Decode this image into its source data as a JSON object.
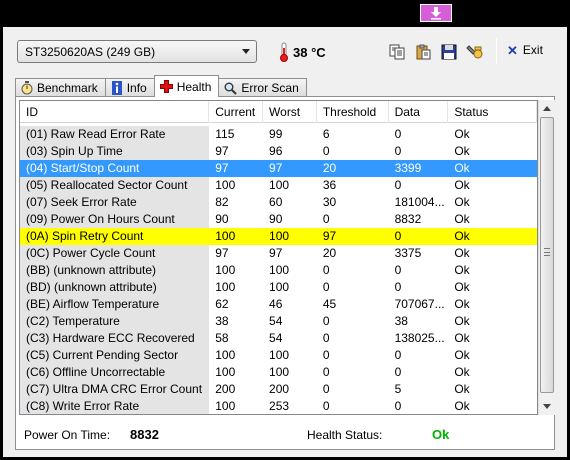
{
  "drive": {
    "selected": "ST3250620AS (249 GB)"
  },
  "temperature": {
    "value": "38 °C"
  },
  "toolbar": {
    "exit_label": "Exit"
  },
  "tabs": [
    {
      "label": "Benchmark",
      "icon": "stopwatch-icon"
    },
    {
      "label": "Info",
      "icon": "info-icon"
    },
    {
      "label": "Health",
      "icon": "red-cross-icon",
      "active": true
    },
    {
      "label": "Error Scan",
      "icon": "magnifier-icon"
    }
  ],
  "table": {
    "columns": [
      "ID",
      "Current",
      "Worst",
      "Threshold",
      "Data",
      "Status"
    ],
    "rows": [
      [
        "(01) Raw Read Error Rate",
        "115",
        "99",
        "6",
        "0",
        "Ok"
      ],
      [
        "(03) Spin Up Time",
        "97",
        "96",
        "0",
        "0",
        "Ok"
      ],
      [
        "(04) Start/Stop Count",
        "97",
        "97",
        "20",
        "3399",
        "Ok"
      ],
      [
        "(05) Reallocated Sector Count",
        "100",
        "100",
        "36",
        "0",
        "Ok"
      ],
      [
        "(07) Seek Error Rate",
        "82",
        "60",
        "30",
        "181004...",
        "Ok"
      ],
      [
        "(09) Power On Hours Count",
        "90",
        "90",
        "0",
        "8832",
        "Ok"
      ],
      [
        "(0A) Spin Retry Count",
        "100",
        "100",
        "97",
        "0",
        "Ok"
      ],
      [
        "(0C) Power Cycle Count",
        "97",
        "97",
        "20",
        "3375",
        "Ok"
      ],
      [
        "(BB) (unknown attribute)",
        "100",
        "100",
        "0",
        "0",
        "Ok"
      ],
      [
        "(BD) (unknown attribute)",
        "100",
        "100",
        "0",
        "0",
        "Ok"
      ],
      [
        "(BE) Airflow Temperature",
        "62",
        "46",
        "45",
        "707067...",
        "Ok"
      ],
      [
        "(C2) Temperature",
        "38",
        "54",
        "0",
        "38",
        "Ok"
      ],
      [
        "(C3) Hardware ECC Recovered",
        "58",
        "54",
        "0",
        "138025...",
        "Ok"
      ],
      [
        "(C5) Current Pending Sector",
        "100",
        "100",
        "0",
        "0",
        "Ok"
      ],
      [
        "(C6) Offline Uncorrectable",
        "100",
        "100",
        "0",
        "0",
        "Ok"
      ],
      [
        "(C7) Ultra DMA CRC Error Count",
        "200",
        "200",
        "0",
        "5",
        "Ok"
      ],
      [
        "(C8) Write Error Rate",
        "100",
        "253",
        "0",
        "0",
        "Ok"
      ]
    ],
    "selected_row": 2,
    "highlighted_row": 6
  },
  "footer": {
    "power_on_label": "Power On Time:",
    "power_on_value": "8832",
    "health_label": "Health Status:",
    "health_value": "Ok"
  },
  "colors": {
    "selection": "#3399ff",
    "highlight": "#ffff00",
    "ok": "#00b400",
    "pin": "#d65ed6"
  }
}
